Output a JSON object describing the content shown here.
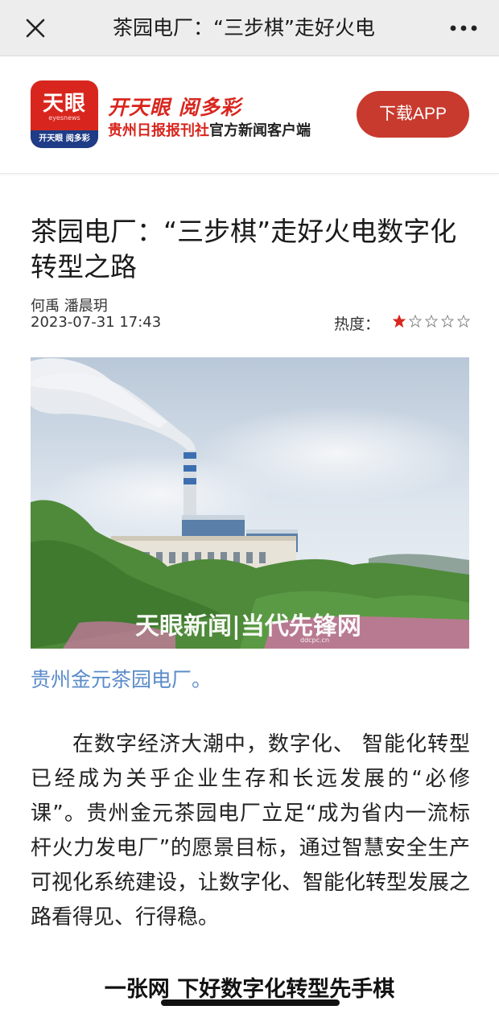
{
  "nav": {
    "title": "茶园电厂：“三步棋”走好火电",
    "close_icon": "close-icon",
    "more_icon": "more-icon"
  },
  "banner": {
    "logo_text": "天眼",
    "logo_subtext": "eyesnews",
    "logo_strip_text": "开天眼 阅多彩",
    "slogan": "开天眼  阅多彩",
    "publisher_red": "贵州日报报刊社",
    "publisher_dark": "官方新闻客户端",
    "download_label": "下载APP",
    "accent_color": "#d8261e"
  },
  "article": {
    "headline": "茶园电厂：“三步棋”走好火电数字化转型之路",
    "authors": "何禹 潘晨玥",
    "datetime": "2023-07-31 17:43",
    "heat_label": "热度：",
    "heat_rating": 1,
    "heat_max": 5,
    "photo_watermark": "天眼新闻|当代先锋网",
    "photo_watermark_sub": "ddcpc.cn",
    "caption": "贵州金元茶园电厂。",
    "paragraph": "在数字经济大潮中，数字化、 智能化转型已经成为关乎企业生存和长远发展的“必修课”。贵州金元茶园电厂立足“成为省内一流标杆火力发电厂”的愿景目标，通过智慧安全生产可视化系统建设，让数字化、智能化转型发展之路看得见、行得稳。",
    "subheading": "一张网 下好数字化转型先手棋",
    "caption_color": "#5b8cc9"
  }
}
